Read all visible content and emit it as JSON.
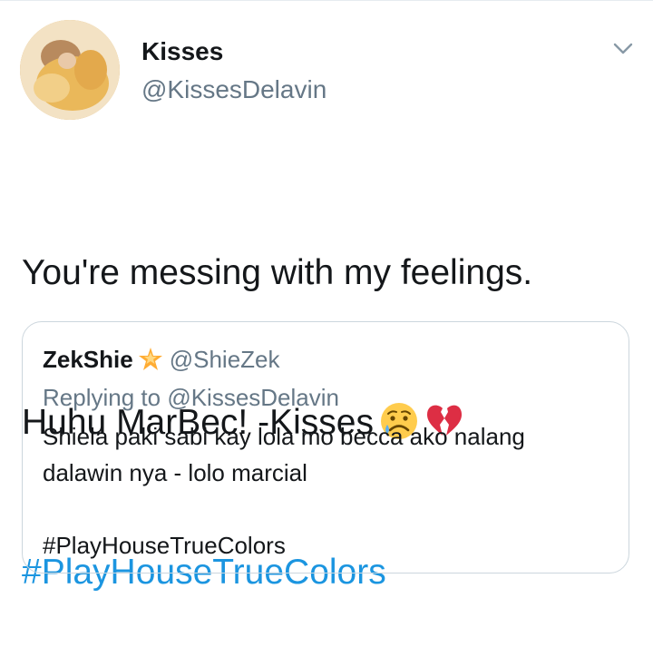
{
  "author": {
    "name": "Kisses",
    "handle": "@KissesDelavin"
  },
  "tweet": {
    "line1": "You're messing with my feelings.",
    "line2": "Huhu MarBec! -Kisses",
    "hashtag": "#PlayHouseTrueColors",
    "emojis": [
      "sad-sweat-face-emoji",
      "broken-heart-emoji"
    ]
  },
  "quoted_tweet": {
    "name": "ZekShie",
    "badge_icon": "star-icon",
    "handle": "@ShieZek",
    "replying_prefix": "Replying to",
    "replying_to": "@KissesDelavin",
    "line1": "Shiela paki sabi kay lola mo becca ako nalang",
    "line2": "dalawin nya - lolo marcial",
    "hashtag": "#PlayHouseTrueColors"
  },
  "colors": {
    "link": "#1b95e0",
    "secondary_text": "#657786",
    "border": "#ccd6dd"
  }
}
